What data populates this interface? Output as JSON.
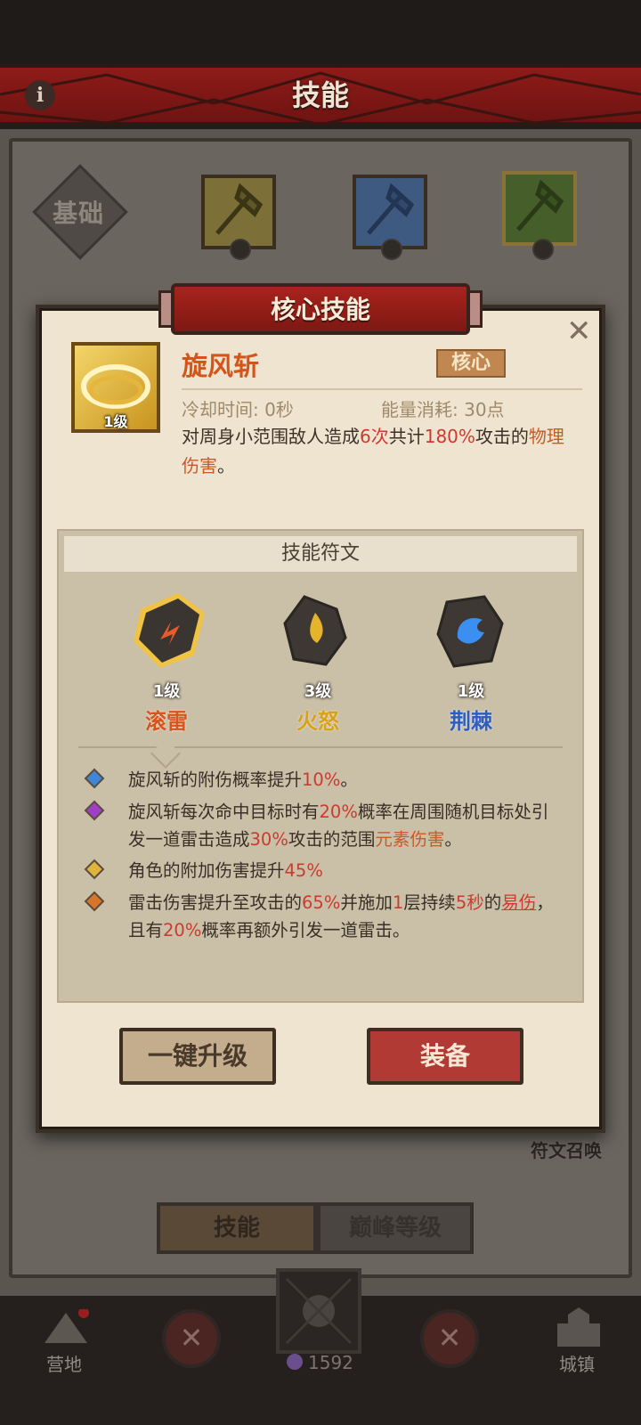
{
  "header": {
    "title": "技能",
    "info_icon": "info-icon"
  },
  "tree": {
    "base_label": "基础",
    "icons": [
      {
        "name": "axe-skill-yellow",
        "color": "#8a7a2d"
      },
      {
        "name": "axe-skill-blue",
        "color": "#3f5c86"
      },
      {
        "name": "axe-skill-green",
        "color": "#4e6d2a"
      }
    ]
  },
  "modal": {
    "title": "核心技能",
    "close_icon": "close-icon",
    "skill": {
      "name": "旋风斩",
      "level": "1级",
      "tag": "核心",
      "cooldown": "冷却时间: 0秒",
      "energy": "能量消耗: 30点",
      "desc_parts": [
        "对周身小范围敌人造成",
        "6次",
        "共计",
        "180%",
        "攻击的",
        "物理伤害",
        "。"
      ]
    },
    "runes": {
      "header": "技能符文",
      "items": [
        {
          "level": "1级",
          "name": "滚雷",
          "color": "#d9531e"
        },
        {
          "level": "3级",
          "name": "火怒",
          "color": "#d7a218"
        },
        {
          "level": "1级",
          "name": "荆棘",
          "color": "#2e5fc0"
        }
      ]
    },
    "effects": [
      {
        "gem_color": "#3f86d8",
        "parts": [
          "旋风斩的附伤概率提升",
          "10%",
          "。"
        ]
      },
      {
        "gem_color": "#a13ec8",
        "parts": [
          "旋风斩每次命中目标时有",
          "20%",
          "概率在周围随机目标处引发一道雷击造成",
          "30%",
          "攻击的范围",
          "元素伤害",
          "。"
        ]
      },
      {
        "gem_color": "#e0b33c",
        "parts": [
          "角色的附加伤害提升",
          "45%"
        ]
      },
      {
        "gem_color": "#d8752a",
        "parts": [
          "雷击伤害提升至攻击的",
          "65%",
          "并施加",
          "1",
          "层持续",
          "5秒",
          "的",
          "易伤",
          "，且有",
          "20%",
          "概率再额外引发一道雷击。"
        ]
      }
    ],
    "buttons": {
      "upgrade": "一键升级",
      "equip": "装备"
    }
  },
  "rune_summon": "符文召唤",
  "bottom_tabs": {
    "skills": "技能",
    "peak": "巅峰等级"
  },
  "nav": {
    "camp": "营地",
    "town": "城镇",
    "currency": "1592"
  }
}
